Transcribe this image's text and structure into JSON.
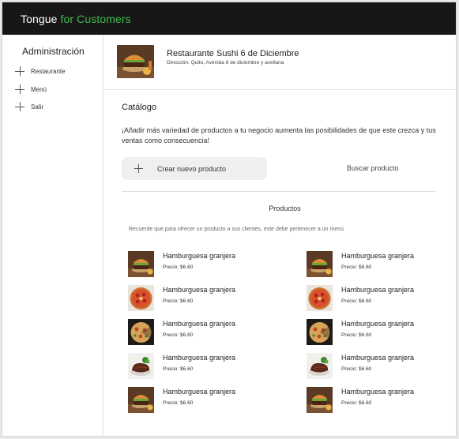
{
  "header": {
    "brand_primary": "Tongue",
    "brand_accent": "for Customers",
    "accent_color": "#3dbd4a"
  },
  "sidebar": {
    "title": "Administración",
    "items": [
      {
        "label": "Restaurante",
        "icon": "plus-icon"
      },
      {
        "label": "Menú",
        "icon": "plus-icon"
      },
      {
        "label": "Salir",
        "icon": "plus-icon"
      }
    ]
  },
  "restaurant": {
    "name": "Restaurante Sushi 6 de Diciembre",
    "address": "Dirección: Quito, Avenida 6 de diciembre y avellana",
    "image": "burger-photo"
  },
  "catalog": {
    "title": "Catálogo",
    "description": "¡Añadir más variedad de productos a tu negocio aumenta las posibilidades de que este crezca y tus ventas como consecuencia!",
    "create_label": "Crear nuevo producto",
    "search_label": "Buscar producto",
    "products_title": "Productos",
    "reminder": "Recuerde que para ofrecer un producto a sus clientes, este debe pertenecer a un menú"
  },
  "products": [
    {
      "name": "Hamburguesa granjera",
      "price": "Precio: $6.60",
      "image": "burger-photo"
    },
    {
      "name": "Hamburguesa granjera",
      "price": "Precio: $6.60",
      "image": "burger-photo"
    },
    {
      "name": "Hamburguesa granjera",
      "price": "Precio: $6.60",
      "image": "pizza-photo"
    },
    {
      "name": "Hamburguesa granjera",
      "price": "Precio: $6.60",
      "image": "pizza-photo"
    },
    {
      "name": "Hamburguesa granjera",
      "price": "Precio: $6.60",
      "image": "pizza-slice-photo"
    },
    {
      "name": "Hamburguesa granjera",
      "price": "Precio: $6.60",
      "image": "pizza-slice-photo"
    },
    {
      "name": "Hamburguesa granjera",
      "price": "Precio: $6.60",
      "image": "steak-photo"
    },
    {
      "name": "Hamburguesa granjera",
      "price": "Precio: $6.60",
      "image": "steak-photo"
    },
    {
      "name": "Hamburguesa granjera",
      "price": "Precio: $6.60",
      "image": "burger-photo"
    },
    {
      "name": "Hamburguesa granjera",
      "price": "Precio: $6.60",
      "image": "burger-photo"
    }
  ]
}
